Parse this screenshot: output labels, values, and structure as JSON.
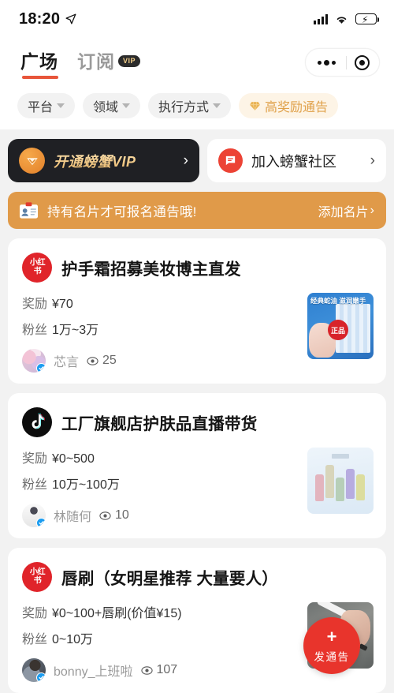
{
  "status_bar": {
    "time": "18:20",
    "location_icon": "location-arrow-icon",
    "signal_icon": "cellular-signal-icon",
    "wifi_icon": "wifi-icon",
    "battery_icon": "battery-charging-icon"
  },
  "header": {
    "tabs": [
      {
        "label": "广场",
        "active": true,
        "badge": null
      },
      {
        "label": "订阅",
        "active": false,
        "badge": "VIP"
      }
    ],
    "capsule": {
      "menu_icon": "more-dots-icon",
      "target_icon": "target-circle-icon"
    }
  },
  "filters": [
    {
      "label": "平台",
      "type": "dropdown",
      "highlight": false
    },
    {
      "label": "领域",
      "type": "dropdown",
      "highlight": false
    },
    {
      "label": "执行方式",
      "type": "dropdown",
      "highlight": false
    },
    {
      "label": "高奖励通告",
      "type": "toggle",
      "highlight": true,
      "icon": "diamond-icon"
    }
  ],
  "banners": {
    "vip": {
      "label": "开通螃蟹VIP",
      "icon": "vip-diamond-icon",
      "chevron": "›"
    },
    "community": {
      "label": "加入螃蟹社区",
      "icon": "chat-bubble-icon",
      "chevron": "›"
    }
  },
  "notice": {
    "icon": "id-card-icon",
    "text": "持有名片才可报名通告哦!",
    "action": "添加名片",
    "chevron": "›"
  },
  "feed": [
    {
      "platform": "小红书",
      "platform_key": "xhs",
      "title": "护手霜招募美妆博主直发",
      "reward_label": "奖励",
      "reward_value": "¥70",
      "fans_label": "粉丝",
      "fans_value": "1万~3万",
      "author": "芯言",
      "verified": true,
      "views_icon": "eye-icon",
      "views": "25",
      "thumb_caption": "经典蛇油 滋润嫩手",
      "thumb_badge": "正品"
    },
    {
      "platform": "抖音",
      "platform_key": "douyin",
      "title": "工厂旗舰店护肤品直播带货",
      "reward_label": "奖励",
      "reward_value": "¥0~500",
      "fans_label": "粉丝",
      "fans_value": "10万~100万",
      "author": "林随何",
      "verified": true,
      "views_icon": "eye-icon",
      "views": "10",
      "thumb_caption": "",
      "thumb_badge": ""
    },
    {
      "platform": "小红书",
      "platform_key": "xhs",
      "title": "唇刷（女明星推荐 大量要人）",
      "reward_label": "奖励",
      "reward_value": "¥0~100+唇刷(价值¥15)",
      "fans_label": "粉丝",
      "fans_value": "0~10万",
      "author": "bonny_上班啦",
      "verified": true,
      "views_icon": "eye-icon",
      "views": "107",
      "thumb_caption": "",
      "thumb_badge": ""
    }
  ],
  "fab": {
    "plus": "+",
    "label": "发通告",
    "icon": "plus-icon"
  },
  "colors": {
    "page_bg": "#f2f2f2",
    "accent_red": "#e8342c",
    "tab_underline": "#e8553a",
    "notice_orange": "#e09a49",
    "vip_dark": "#1f2024",
    "gold": "#e0a14a",
    "xhs_red": "#e0242a",
    "verified_blue": "#1a9cf0"
  }
}
